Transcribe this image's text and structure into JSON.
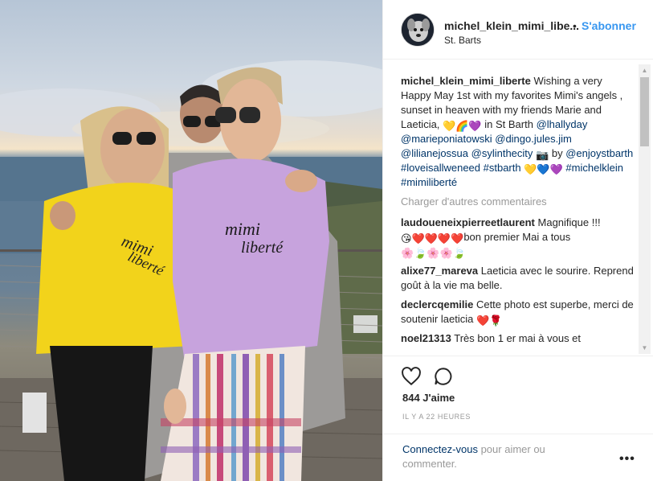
{
  "post": {
    "username": "michel_klein_mimi_libe...",
    "location": "St. Barts",
    "follow_separator": "•",
    "follow_label": "S'abonner"
  },
  "caption": {
    "username": "michel_klein_mimi_liberte",
    "text_1": "Wishing a very Happy May 1st with my favorites Mimi's angels , sunset in heaven with my friends Marie and Laeticia,",
    "emoji_1": "💛🌈💜",
    "text_2": "in St Barth",
    "mentions_1": "@lhallyday @marieponiatowski @dingo.jules.jim @lilianejossua @sylinthecity",
    "emoji_2": "📷",
    "text_3": "by",
    "mention_2": "@enjoystbarth",
    "hashtags_1": "#loveisallweneed #stbarth",
    "emoji_3": "💛💙💜",
    "hashtags_2": "#michelklein #mimiliberté"
  },
  "load_more": "Charger d'autres commentaires",
  "comments": [
    {
      "username": "laudoueneixpierreetlaurent",
      "text": "Magnifique !!!",
      "emoji_a": "😘❤️❤️❤️❤️",
      "text_b": "bon premier Mai a tous",
      "emoji_b": "🌸🍃🌸🌸🍃"
    },
    {
      "username": "alixe77_mareva",
      "text": "Laeticia avec le sourire. Reprend goût à la vie ma belle."
    },
    {
      "username": "declercqemilie",
      "text": "Cette photo est superbe, merci de soutenir laeticia",
      "emoji": "❤️🌹"
    },
    {
      "username": "noel21313",
      "text": "Très bon 1 er mai à vous et"
    }
  ],
  "actions": {
    "likes": "844 J'aime",
    "time_ago": "IL Y A 22 HEURES",
    "login_link": "Connectez-vous",
    "login_text": "pour aimer ou commenter.",
    "more": "•••"
  },
  "icons": {
    "heart": "heart-icon",
    "comment": "comment-icon",
    "more": "more-options-icon",
    "scroll_up": "scroll-up-icon",
    "scroll_down": "scroll-down-icon"
  }
}
